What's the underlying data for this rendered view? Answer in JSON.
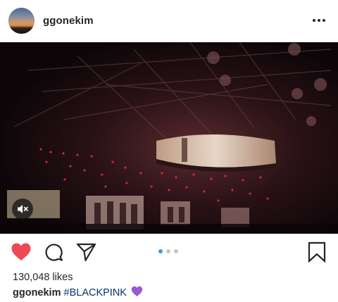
{
  "post": {
    "username": "ggonekim",
    "likes_text": "130,048 likes",
    "caption": {
      "username": "ggonekim",
      "hashtag": "#BLACKPINK"
    }
  },
  "carousel": {
    "count": 3,
    "active_index": 0
  },
  "media": {
    "type": "video",
    "muted": true
  },
  "icons": {
    "more": "more-options-icon",
    "mute": "muted-speaker-icon",
    "like": "heart-icon",
    "comment": "comment-bubble-icon",
    "share": "paper-plane-icon",
    "save": "bookmark-icon",
    "caption_emoji": "purple-heart-emoji"
  },
  "colors": {
    "like_active": "#ed4956",
    "hashtag": "#003569",
    "dot_active": "#3897f0",
    "emoji_purple": "#9b59d0"
  }
}
